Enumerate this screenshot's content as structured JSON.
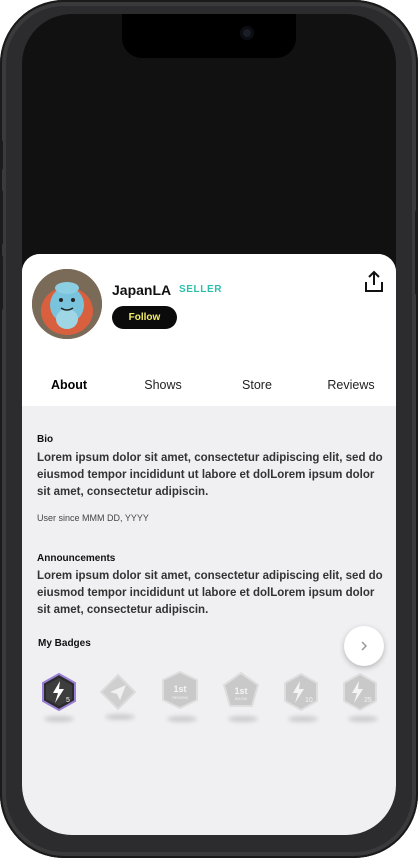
{
  "profile": {
    "name": "JapanLA",
    "role_badge": "SELLER",
    "follow_label": "Follow",
    "avatar_icon": "avatar-plush-toy"
  },
  "tabs": [
    {
      "label": "About",
      "active": true
    },
    {
      "label": "Shows",
      "active": false
    },
    {
      "label": "Store",
      "active": false
    },
    {
      "label": "Reviews",
      "active": false
    }
  ],
  "bio": {
    "title": "Bio",
    "text": "Lorem ipsum dolor sit amet, consectetur adipiscing elit, sed do eiusmod tempor incididunt ut labore et dolLorem ipsum dolor sit amet, consectetur adipiscin.",
    "user_since": "User since MMM DD, YYYY"
  },
  "announcements": {
    "title": "Announcements",
    "text": "Lorem ipsum dolor sit amet, consectetur adipiscing elit, sed do eiusmod tempor incididunt ut labore et dolLorem ipsum dolor sit amet, consectetur adipiscin."
  },
  "badges": {
    "title": "My Badges",
    "items": [
      {
        "icon": "lightning-icon",
        "label": "5",
        "earned": true
      },
      {
        "icon": "paper-plane-icon",
        "label": "",
        "earned": false
      },
      {
        "icon": "first-review-icon",
        "label": "1st",
        "sub": "REVIEW",
        "earned": false
      },
      {
        "icon": "first-show-icon",
        "label": "1st",
        "sub": "SHOW",
        "earned": false
      },
      {
        "icon": "lightning-icon",
        "label": "10",
        "earned": false
      },
      {
        "icon": "lightning-icon",
        "label": "25",
        "earned": false
      }
    ]
  },
  "colors": {
    "accent": "#2fc0ab",
    "follow_text": "#f4ed6a",
    "sheet_bg": "#f0f0f2"
  }
}
